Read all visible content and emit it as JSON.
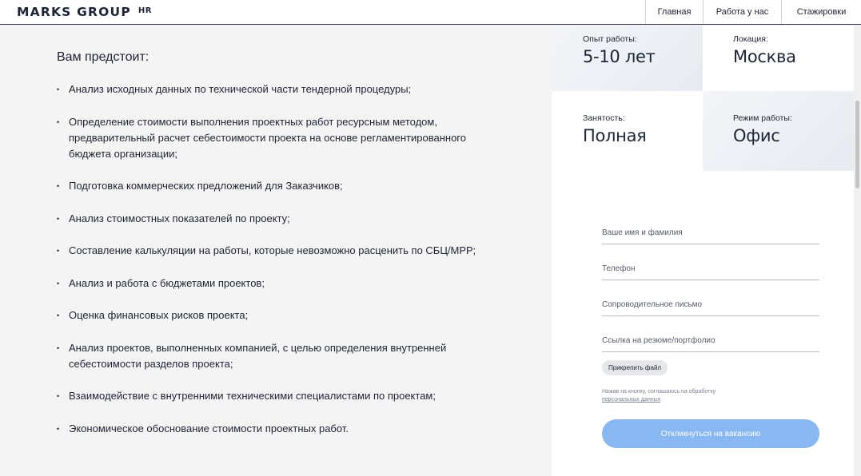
{
  "header": {
    "logo_main": "MARKS GROUP",
    "logo_sub": "HR",
    "nav": [
      {
        "label": "Главная"
      },
      {
        "label": "Работа у нас"
      },
      {
        "label": "Стажировки"
      }
    ]
  },
  "content": {
    "title": "Вам предстоит:",
    "duties": [
      "Анализ исходных данных по технической части тендерной процедуры;",
      "Определение стоимости выполнения проектных работ ресурсным методом, предварительный расчет себестоимости проекта на основе регламентированного бюджета организации;",
      "Подготовка коммерческих предложений для Заказчиков;",
      "Анализ стоимостных показателей по проекту;",
      "Составление калькуляции на работы, которые невозможно расценить по СБЦ/МРР;",
      "Анализ и работа с бюджетами проектов;",
      "Оценка финансовых рисков проекта;",
      "Анализ проектов, выполненных компанией, с целью определения внутренней себестоимости разделов проекта;",
      "Взаимодействие с внутренними техническими специалистами по проектам;",
      "Экономическое обоснование стоимости проектных работ."
    ]
  },
  "info": {
    "experience": {
      "label": "Опыт работы:",
      "value": "5-10 лет"
    },
    "location": {
      "label": "Локация:",
      "value": "Москва"
    },
    "employment": {
      "label": "Занятость:",
      "value": "Полная"
    },
    "mode": {
      "label": "Режим работы:",
      "value": "Офис"
    }
  },
  "form": {
    "name_placeholder": "Ваше имя и фамилия",
    "phone_placeholder": "Телефон",
    "letter_placeholder": "Сопроводительное письмо",
    "link_placeholder": "Ссылка на резюме/портфолио",
    "attach_label": "Прикрепить файл",
    "consent_text": "Нажав на кнопку, соглашаюсь на обработку",
    "consent_link": "персональных данных",
    "submit_label": "Откликнуться на вакансию"
  },
  "colors": {
    "accent": "#89b7f2",
    "text": "#1d2330"
  }
}
